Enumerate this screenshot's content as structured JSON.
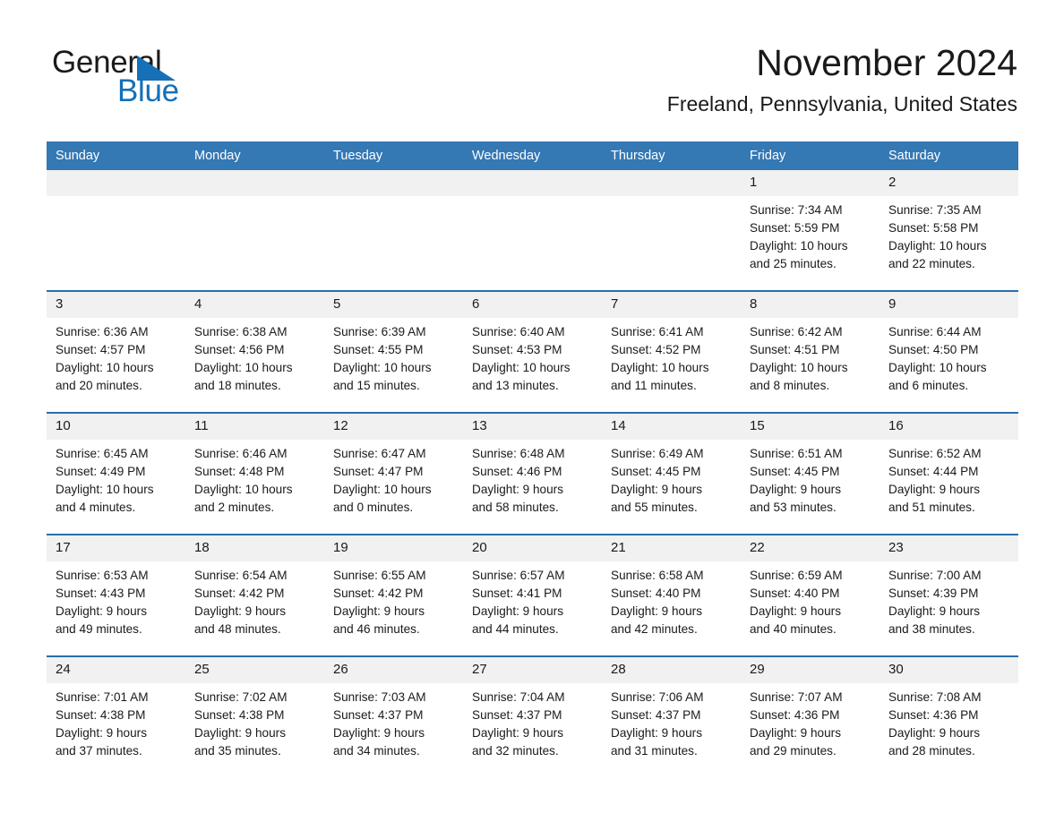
{
  "brand": {
    "name_part1": "General",
    "name_part2": "Blue",
    "logo_icon": "triangle-flag-icon",
    "accent_color": "#1570b8"
  },
  "header": {
    "month_title": "November 2024",
    "location": "Freeland, Pennsylvania, United States"
  },
  "calendar": {
    "header_bg": "#3478b4",
    "row_divider_color": "#2a6ead",
    "daynum_bg": "#f1f1f1",
    "weekday_headers": [
      "Sunday",
      "Monday",
      "Tuesday",
      "Wednesday",
      "Thursday",
      "Friday",
      "Saturday"
    ],
    "weeks": [
      [
        {
          "day": "",
          "lines": []
        },
        {
          "day": "",
          "lines": []
        },
        {
          "day": "",
          "lines": []
        },
        {
          "day": "",
          "lines": []
        },
        {
          "day": "",
          "lines": []
        },
        {
          "day": "1",
          "lines": [
            "Sunrise: 7:34 AM",
            "Sunset: 5:59 PM",
            "Daylight: 10 hours",
            "and 25 minutes."
          ]
        },
        {
          "day": "2",
          "lines": [
            "Sunrise: 7:35 AM",
            "Sunset: 5:58 PM",
            "Daylight: 10 hours",
            "and 22 minutes."
          ]
        }
      ],
      [
        {
          "day": "3",
          "lines": [
            "Sunrise: 6:36 AM",
            "Sunset: 4:57 PM",
            "Daylight: 10 hours",
            "and 20 minutes."
          ]
        },
        {
          "day": "4",
          "lines": [
            "Sunrise: 6:38 AM",
            "Sunset: 4:56 PM",
            "Daylight: 10 hours",
            "and 18 minutes."
          ]
        },
        {
          "day": "5",
          "lines": [
            "Sunrise: 6:39 AM",
            "Sunset: 4:55 PM",
            "Daylight: 10 hours",
            "and 15 minutes."
          ]
        },
        {
          "day": "6",
          "lines": [
            "Sunrise: 6:40 AM",
            "Sunset: 4:53 PM",
            "Daylight: 10 hours",
            "and 13 minutes."
          ]
        },
        {
          "day": "7",
          "lines": [
            "Sunrise: 6:41 AM",
            "Sunset: 4:52 PM",
            "Daylight: 10 hours",
            "and 11 minutes."
          ]
        },
        {
          "day": "8",
          "lines": [
            "Sunrise: 6:42 AM",
            "Sunset: 4:51 PM",
            "Daylight: 10 hours",
            "and 8 minutes."
          ]
        },
        {
          "day": "9",
          "lines": [
            "Sunrise: 6:44 AM",
            "Sunset: 4:50 PM",
            "Daylight: 10 hours",
            "and 6 minutes."
          ]
        }
      ],
      [
        {
          "day": "10",
          "lines": [
            "Sunrise: 6:45 AM",
            "Sunset: 4:49 PM",
            "Daylight: 10 hours",
            "and 4 minutes."
          ]
        },
        {
          "day": "11",
          "lines": [
            "Sunrise: 6:46 AM",
            "Sunset: 4:48 PM",
            "Daylight: 10 hours",
            "and 2 minutes."
          ]
        },
        {
          "day": "12",
          "lines": [
            "Sunrise: 6:47 AM",
            "Sunset: 4:47 PM",
            "Daylight: 10 hours",
            "and 0 minutes."
          ]
        },
        {
          "day": "13",
          "lines": [
            "Sunrise: 6:48 AM",
            "Sunset: 4:46 PM",
            "Daylight: 9 hours",
            "and 58 minutes."
          ]
        },
        {
          "day": "14",
          "lines": [
            "Sunrise: 6:49 AM",
            "Sunset: 4:45 PM",
            "Daylight: 9 hours",
            "and 55 minutes."
          ]
        },
        {
          "day": "15",
          "lines": [
            "Sunrise: 6:51 AM",
            "Sunset: 4:45 PM",
            "Daylight: 9 hours",
            "and 53 minutes."
          ]
        },
        {
          "day": "16",
          "lines": [
            "Sunrise: 6:52 AM",
            "Sunset: 4:44 PM",
            "Daylight: 9 hours",
            "and 51 minutes."
          ]
        }
      ],
      [
        {
          "day": "17",
          "lines": [
            "Sunrise: 6:53 AM",
            "Sunset: 4:43 PM",
            "Daylight: 9 hours",
            "and 49 minutes."
          ]
        },
        {
          "day": "18",
          "lines": [
            "Sunrise: 6:54 AM",
            "Sunset: 4:42 PM",
            "Daylight: 9 hours",
            "and 48 minutes."
          ]
        },
        {
          "day": "19",
          "lines": [
            "Sunrise: 6:55 AM",
            "Sunset: 4:42 PM",
            "Daylight: 9 hours",
            "and 46 minutes."
          ]
        },
        {
          "day": "20",
          "lines": [
            "Sunrise: 6:57 AM",
            "Sunset: 4:41 PM",
            "Daylight: 9 hours",
            "and 44 minutes."
          ]
        },
        {
          "day": "21",
          "lines": [
            "Sunrise: 6:58 AM",
            "Sunset: 4:40 PM",
            "Daylight: 9 hours",
            "and 42 minutes."
          ]
        },
        {
          "day": "22",
          "lines": [
            "Sunrise: 6:59 AM",
            "Sunset: 4:40 PM",
            "Daylight: 9 hours",
            "and 40 minutes."
          ]
        },
        {
          "day": "23",
          "lines": [
            "Sunrise: 7:00 AM",
            "Sunset: 4:39 PM",
            "Daylight: 9 hours",
            "and 38 minutes."
          ]
        }
      ],
      [
        {
          "day": "24",
          "lines": [
            "Sunrise: 7:01 AM",
            "Sunset: 4:38 PM",
            "Daylight: 9 hours",
            "and 37 minutes."
          ]
        },
        {
          "day": "25",
          "lines": [
            "Sunrise: 7:02 AM",
            "Sunset: 4:38 PM",
            "Daylight: 9 hours",
            "and 35 minutes."
          ]
        },
        {
          "day": "26",
          "lines": [
            "Sunrise: 7:03 AM",
            "Sunset: 4:37 PM",
            "Daylight: 9 hours",
            "and 34 minutes."
          ]
        },
        {
          "day": "27",
          "lines": [
            "Sunrise: 7:04 AM",
            "Sunset: 4:37 PM",
            "Daylight: 9 hours",
            "and 32 minutes."
          ]
        },
        {
          "day": "28",
          "lines": [
            "Sunrise: 7:06 AM",
            "Sunset: 4:37 PM",
            "Daylight: 9 hours",
            "and 31 minutes."
          ]
        },
        {
          "day": "29",
          "lines": [
            "Sunrise: 7:07 AM",
            "Sunset: 4:36 PM",
            "Daylight: 9 hours",
            "and 29 minutes."
          ]
        },
        {
          "day": "30",
          "lines": [
            "Sunrise: 7:08 AM",
            "Sunset: 4:36 PM",
            "Daylight: 9 hours",
            "and 28 minutes."
          ]
        }
      ]
    ]
  }
}
